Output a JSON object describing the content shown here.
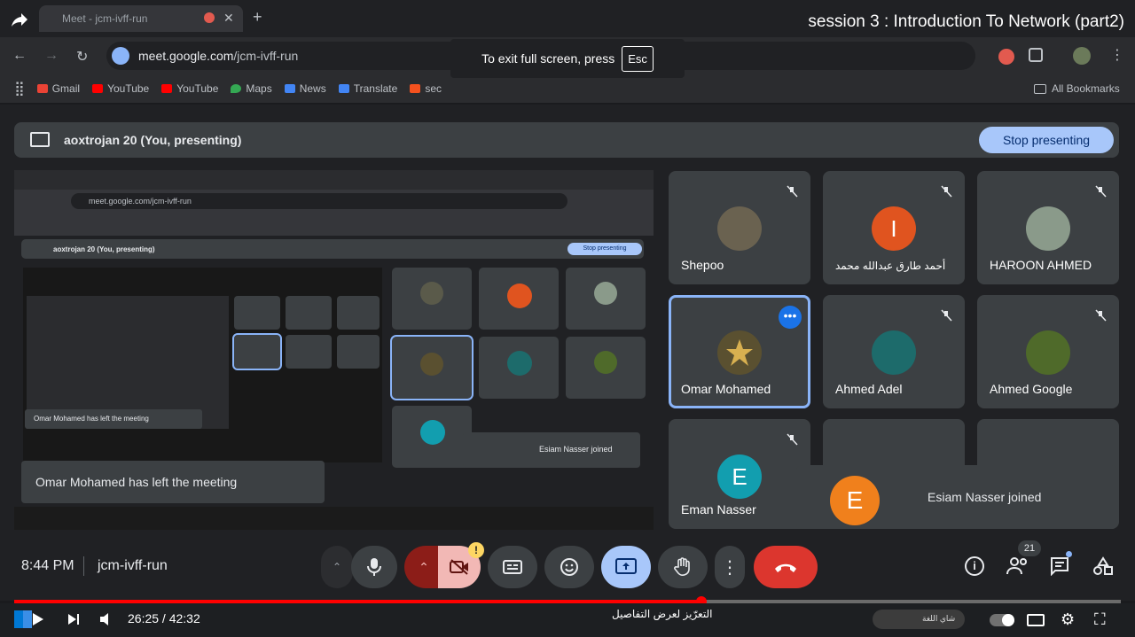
{
  "browser": {
    "tab_title": "Meet - jcm-ivff-run",
    "url_host": "meet.google.com",
    "url_path": "/jcm-ivff-run",
    "bookmarks": [
      "Gmail",
      "YouTube",
      "YouTube",
      "Maps",
      "News",
      "Translate",
      "sec"
    ],
    "all_bookmarks": "All Bookmarks"
  },
  "fullscreen_toast": {
    "text": "To exit full screen, press",
    "key": "Esc"
  },
  "video_title": "session 3 : Introduction To Network (part2)",
  "meet": {
    "presenting_label": "aoxtrojan 20 (You, presenting)",
    "stop_presenting": "Stop presenting",
    "left_notice": "Omar Mohamed has left the meeting",
    "join_notice": "Esiam Nasser joined",
    "join_initial": "E",
    "time": "8:44 PM",
    "meeting_code": "jcm-ivff-run",
    "participant_count": "21",
    "participants": [
      {
        "name": "Shepoo",
        "initial": ""
      },
      {
        "name": "أحمد طارق عبدالله محمد",
        "initial": "I"
      },
      {
        "name": "HAROON AHMED",
        "initial": ""
      },
      {
        "name": "Omar Mohamed",
        "initial": ""
      },
      {
        "name": "Ahmed Adel",
        "initial": ""
      },
      {
        "name": "Ahmed Google",
        "initial": ""
      },
      {
        "name": "Eman Nasser",
        "initial": "E"
      }
    ],
    "colors": {
      "accent": "#a8c7fa",
      "end_call": "#ea4335",
      "avatar_orange": "#e0541f",
      "avatar_teal": "#129eaf",
      "avatar_amber": "#f0801c"
    }
  },
  "nested": {
    "url": "meet.google.com/jcm-ivff-run",
    "presenting": "aoxtrojan 20 (You, presenting)",
    "stop": "Stop presenting",
    "notice": "Omar Mohamed has left the meeting",
    "join": "Esiam Nasser joined"
  },
  "youtube": {
    "current": "26:25",
    "duration": "42:32",
    "progress": 0.621,
    "chapter": "التعرّيز لعرض التفاصيل",
    "caption_label": "شاي اللغة"
  }
}
